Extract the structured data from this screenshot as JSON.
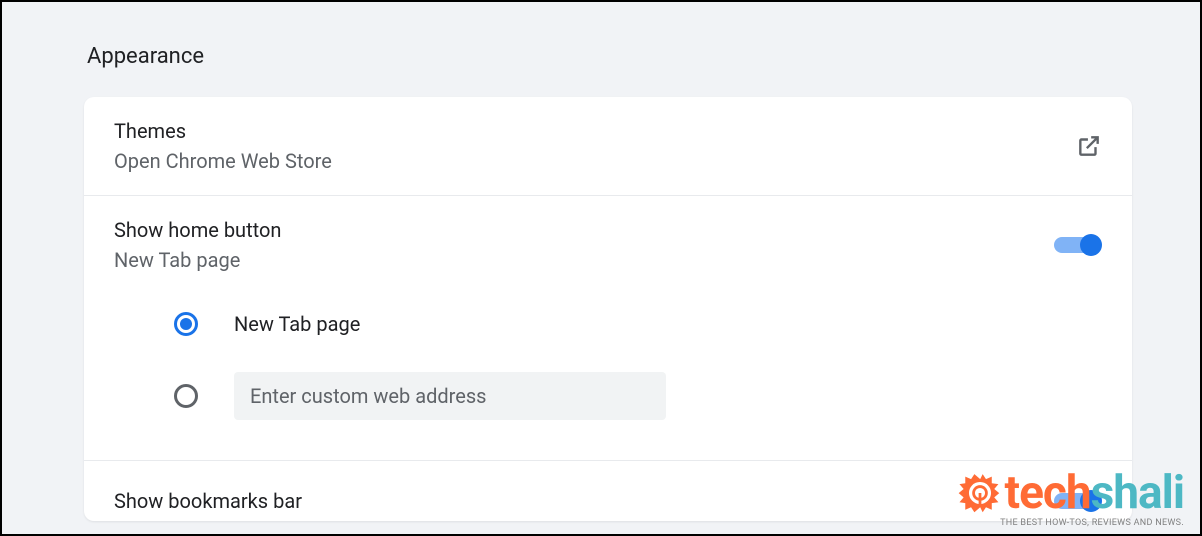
{
  "section": {
    "title": "Appearance"
  },
  "themes": {
    "title": "Themes",
    "subtitle": "Open Chrome Web Store"
  },
  "homeButton": {
    "title": "Show home button",
    "subtitle": "New Tab page",
    "enabled": true,
    "options": {
      "newTab": "New Tab page",
      "customPlaceholder": "Enter custom web address",
      "customValue": ""
    }
  },
  "bookmarks": {
    "title": "Show bookmarks bar",
    "enabled": true
  },
  "watermark": {
    "brandA": "tech",
    "brandB": "shali",
    "tagline": "THE BEST HOW-TOS, REVIEWS AND NEWS."
  }
}
